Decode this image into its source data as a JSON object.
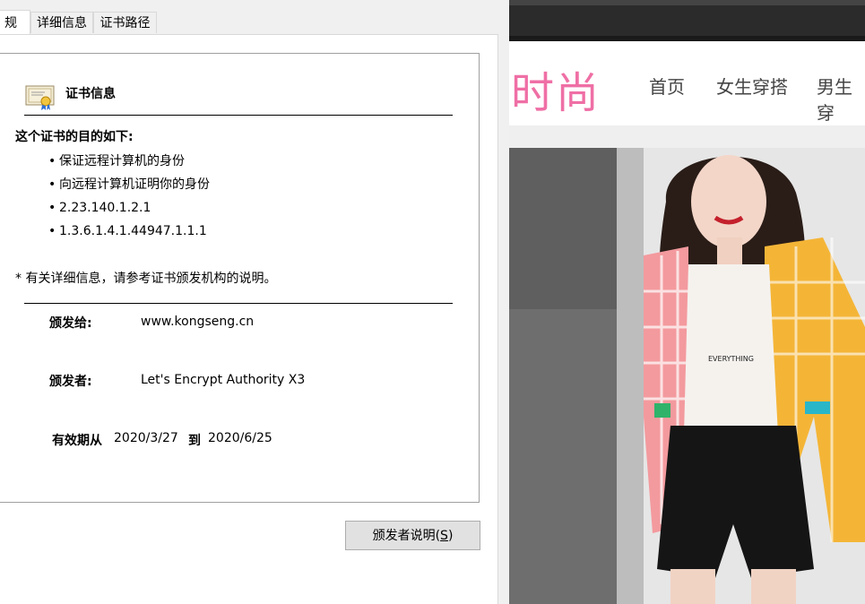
{
  "tabs": [
    {
      "label": "规",
      "active": true
    },
    {
      "label": "详细信息",
      "active": false
    },
    {
      "label": "证书路径",
      "active": false
    }
  ],
  "cert": {
    "icon": "certificate-icon",
    "heading": "证书信息",
    "purpose_title": "这个证书的目的如下:",
    "purposes": [
      "保证远程计算机的身份",
      "向远程计算机证明你的身份",
      "2.23.140.1.2.1",
      "1.3.6.1.4.1.44947.1.1.1"
    ],
    "note": "* 有关详细信息，请参考证书颁发机构的说明。",
    "issued_to_label": "颁发给:",
    "issued_to": "www.kongseng.cn",
    "issued_by_label": "颁发者:",
    "issued_by": "Let's Encrypt Authority X3",
    "valid_from_label": "有效期从",
    "valid_from": "2020/3/27",
    "valid_to_label": "到",
    "valid_to": "2020/6/25"
  },
  "buttons": {
    "issuer_statement": "颁发者说明(",
    "issuer_statement_key": "S",
    "issuer_statement_end": ")"
  },
  "site": {
    "logo": "时尚",
    "nav": [
      "首页",
      "女生穿搭",
      "男生穿"
    ],
    "colors": {
      "logo": "#ef6fa5",
      "topbar": "#2b2b2b"
    }
  }
}
